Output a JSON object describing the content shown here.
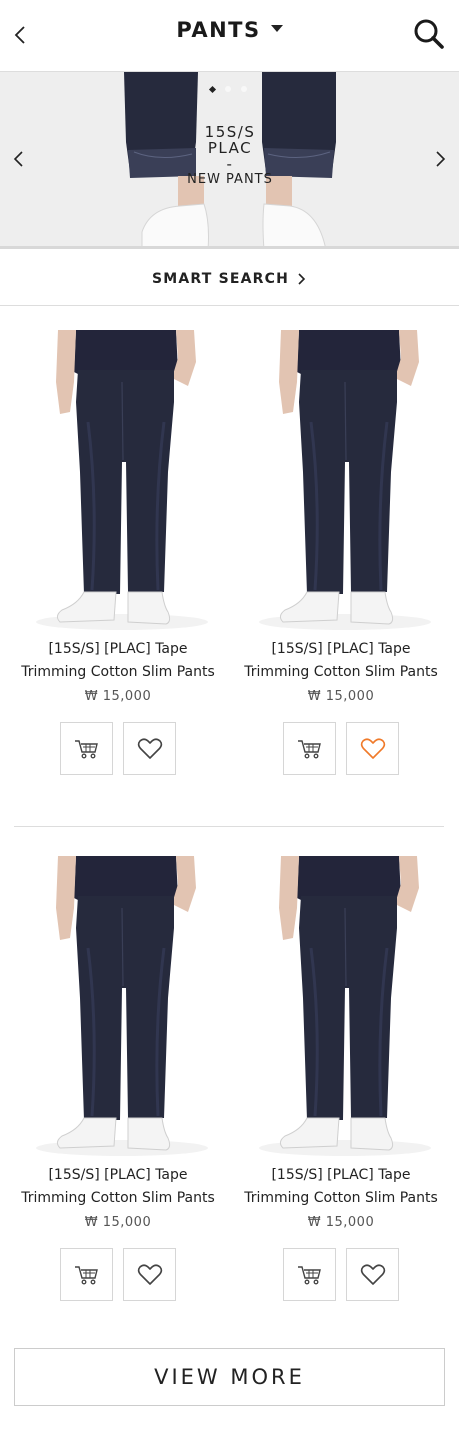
{
  "header": {
    "title": "PANTS",
    "back_icon": "chevron-left-icon",
    "dropdown_icon": "caret-down-icon",
    "search_icon": "search-icon"
  },
  "banner": {
    "line1": "15S/S",
    "line2": "PLAC",
    "line3": "-",
    "line4": "NEW PANTS",
    "slide_count": 3,
    "active_slide": 1
  },
  "smart_search": {
    "label": "SMART SEARCH"
  },
  "products": [
    {
      "name_line1": "[15S/S] [PLAC] Tape",
      "name_line2": "Trimming Cotton Slim Pants",
      "price": "₩ 15,000",
      "wishlisted": false
    },
    {
      "name_line1": "[15S/S] [PLAC] Tape",
      "name_line2": "Trimming Cotton Slim Pants",
      "price": "₩ 15,000",
      "wishlisted": true
    },
    {
      "name_line1": "[15S/S] [PLAC] Tape",
      "name_line2": "Trimming Cotton Slim Pants",
      "price": "₩ 15,000",
      "wishlisted": false
    },
    {
      "name_line1": "[15S/S] [PLAC] Tape",
      "name_line2": "Trimming Cotton Slim Pants",
      "price": "₩ 15,000",
      "wishlisted": false
    }
  ],
  "view_more": {
    "label": "VIEW MORE"
  },
  "colors": {
    "wishlist_active": "#f07a2a",
    "icon": "#444444",
    "denim": "#262a3d"
  }
}
